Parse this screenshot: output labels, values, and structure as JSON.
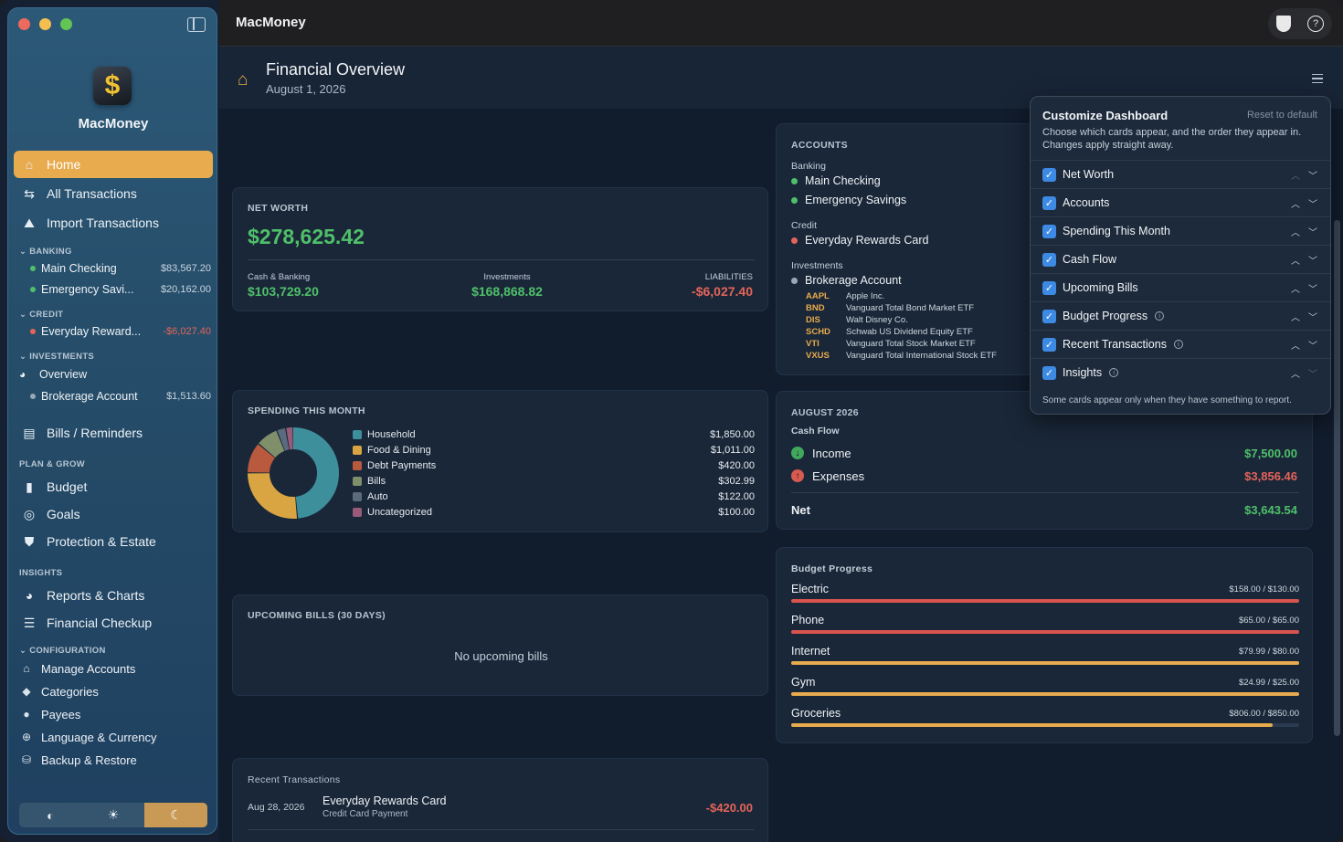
{
  "app": {
    "name": "MacMoney",
    "title": "MacMoney"
  },
  "sidebar": {
    "nav": [
      {
        "label": "Home",
        "icon": "home-icon",
        "active": true
      },
      {
        "label": "All Transactions",
        "icon": "arrows-swap-icon"
      },
      {
        "label": "Import Transactions",
        "icon": "import-icon"
      }
    ],
    "banking_header": "BANKING",
    "banking": [
      {
        "label": "Main Checking",
        "amount": "$83,567.20",
        "color": "#4fc06a"
      },
      {
        "label": "Emergency Savi...",
        "amount": "$20,162.00",
        "color": "#4fc06a"
      }
    ],
    "credit_header": "CREDIT",
    "credit": [
      {
        "label": "Everyday Reward...",
        "amount": "-$6,027.40",
        "color": "#e4645a"
      }
    ],
    "investments_header": "INVESTMENTS",
    "investments_overview": "Overview",
    "investments": [
      {
        "label": "Brokerage Account",
        "amount": "$1,513.60",
        "color": "#9aa8b8"
      }
    ],
    "bills": "Bills / Reminders",
    "plan_header": "PLAN & GROW",
    "plan": [
      {
        "label": "Budget"
      },
      {
        "label": "Goals"
      },
      {
        "label": "Protection & Estate"
      }
    ],
    "insights_header": "INSIGHTS",
    "insights": [
      {
        "label": "Reports & Charts"
      },
      {
        "label": "Financial Checkup"
      }
    ],
    "config_header": "CONFIGURATION",
    "config": [
      {
        "label": "Manage Accounts"
      },
      {
        "label": "Categories"
      },
      {
        "label": "Payees"
      },
      {
        "label": "Language & Currency"
      },
      {
        "label": "Backup & Restore"
      }
    ],
    "theme_options": [
      "auto-contrast-icon",
      "sun-icon",
      "moon-icon"
    ],
    "theme_selected": "moon-icon"
  },
  "header": {
    "title": "Financial Overview",
    "date": "August 1, 2026"
  },
  "net_worth": {
    "label": "NET WORTH",
    "value": "$278,625.42",
    "cash_label": "Cash & Banking",
    "cash_value": "$103,729.20",
    "inv_label": "Investments",
    "inv_value": "$168,868.82",
    "liab_label": "LIABILITIES",
    "liab_value": "-$6,027.40"
  },
  "accounts": {
    "label": "ACCOUNTS",
    "banking_label": "Banking",
    "banking": [
      "Main Checking",
      "Emergency Savings"
    ],
    "credit_label": "Credit",
    "credit": [
      "Everyday Rewards Card"
    ],
    "investments_label": "Investments",
    "investments": [
      "Brokerage Account"
    ],
    "holdings": [
      {
        "ticker": "AAPL",
        "name": "Apple Inc."
      },
      {
        "ticker": "BND",
        "name": "Vanguard Total Bond Market ETF"
      },
      {
        "ticker": "DIS",
        "name": "Walt Disney Co."
      },
      {
        "ticker": "SCHD",
        "name": "Schwab US Dividend Equity ETF"
      },
      {
        "ticker": "VTI",
        "name": "Vanguard Total Stock Market ETF"
      },
      {
        "ticker": "VXUS",
        "name": "Vanguard Total International Stock ETF"
      }
    ]
  },
  "spending": {
    "label": "SPENDING THIS MONTH",
    "items": [
      {
        "label": "Household",
        "value": "$1,850.00",
        "amount": 1850,
        "color": "#3e8f9c"
      },
      {
        "label": "Food & Dining",
        "value": "$1,011.00",
        "amount": 1011,
        "color": "#d9a543"
      },
      {
        "label": "Debt Payments",
        "value": "$420.00",
        "amount": 420,
        "color": "#b95a3f"
      },
      {
        "label": "Bills",
        "value": "$302.99",
        "amount": 302.99,
        "color": "#7f8f6a"
      },
      {
        "label": "Auto",
        "value": "$122.00",
        "amount": 122,
        "color": "#5b6b7d"
      },
      {
        "label": "Uncategorized",
        "value": "$100.00",
        "amount": 100,
        "color": "#9a5b7a"
      }
    ]
  },
  "cash_flow": {
    "label": "AUGUST 2026",
    "sub": "Cash Flow",
    "income_label": "Income",
    "income_value": "$7,500.00",
    "expenses_label": "Expenses",
    "expenses_value": "$3,856.46",
    "net_label": "Net",
    "net_value": "$3,643.54"
  },
  "bills": {
    "label": "UPCOMING BILLS (30 DAYS)",
    "empty": "No upcoming bills"
  },
  "budget": {
    "label": "Budget Progress",
    "items": [
      {
        "name": "Electric",
        "amount": "$158.00 / $130.00",
        "progress": 1.0,
        "color": "#d9534f"
      },
      {
        "name": "Phone",
        "amount": "$65.00 / $65.00",
        "progress": 1.0,
        "color": "#d9534f"
      },
      {
        "name": "Internet",
        "amount": "$79.99 / $80.00",
        "progress": 1.0,
        "color": "#e8ab4e"
      },
      {
        "name": "Gym",
        "amount": "$24.99 / $25.00",
        "progress": 1.0,
        "color": "#e8ab4e"
      },
      {
        "name": "Groceries",
        "amount": "$806.00 / $850.00",
        "progress": 0.948,
        "color": "#e8ab4e"
      }
    ]
  },
  "recent": {
    "label": "Recent Transactions",
    "items": [
      {
        "date": "Aug 28, 2026",
        "payee": "Everyday Rewards Card",
        "memo": "Credit Card Payment",
        "amount": "-$420.00"
      }
    ]
  },
  "customize": {
    "title": "Customize Dashboard",
    "reset": "Reset to default",
    "desc": "Choose which cards appear, and the order they appear in. Changes apply straight away.",
    "rows": [
      {
        "label": "Net Worth",
        "checked": true,
        "info": false
      },
      {
        "label": "Accounts",
        "checked": true,
        "info": false
      },
      {
        "label": "Spending This Month",
        "checked": true,
        "info": false
      },
      {
        "label": "Cash Flow",
        "checked": true,
        "info": false
      },
      {
        "label": "Upcoming Bills",
        "checked": true,
        "info": false
      },
      {
        "label": "Budget Progress",
        "checked": true,
        "info": true
      },
      {
        "label": "Recent Transactions",
        "checked": true,
        "info": true
      },
      {
        "label": "Insights",
        "checked": true,
        "info": true
      }
    ],
    "footer": "Some cards appear only when they have something to report."
  }
}
